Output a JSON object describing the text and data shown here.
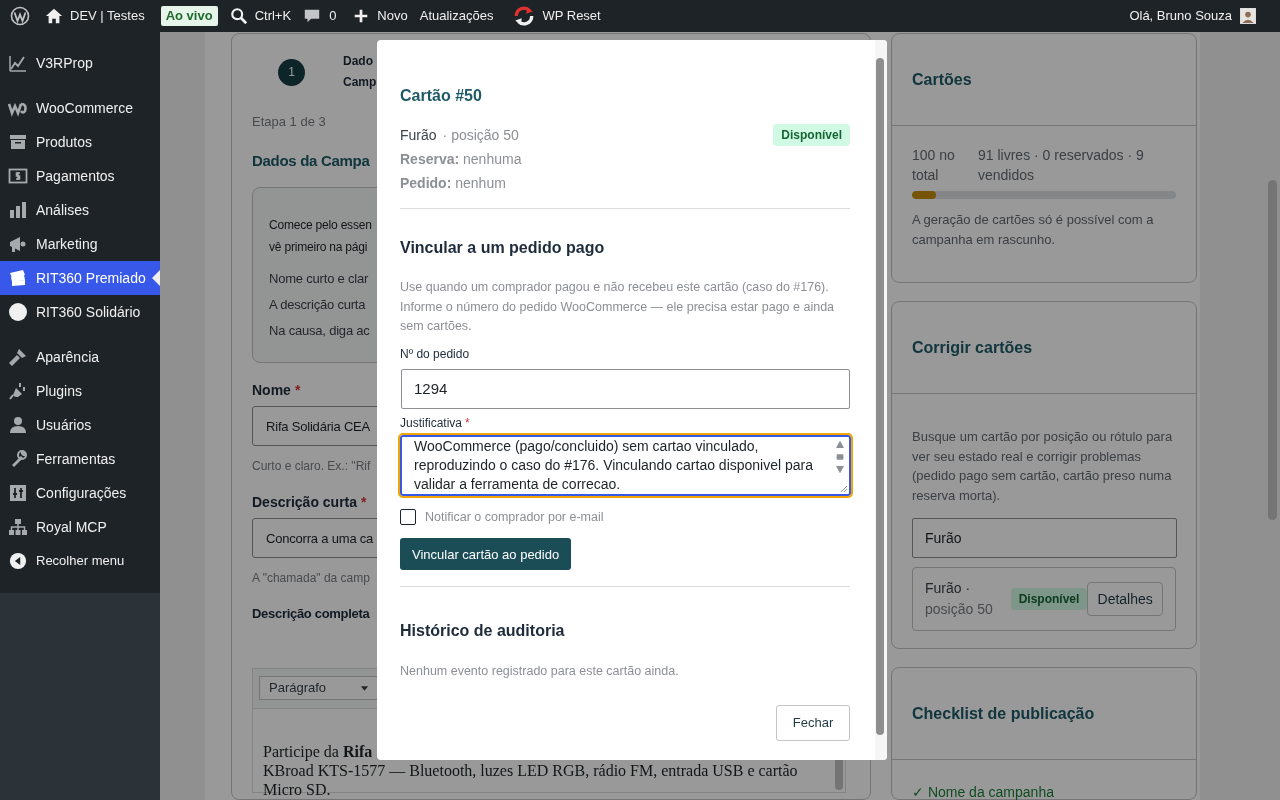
{
  "admin_bar": {
    "items": [
      {
        "kind": "logo"
      },
      {
        "kind": "home",
        "label": "DEV | Testes"
      },
      {
        "kind": "badge",
        "label": "Ao vivo"
      },
      {
        "kind": "search",
        "label": "Ctrl+K"
      },
      {
        "kind": "comments",
        "label": "0"
      },
      {
        "kind": "new",
        "label": "Novo"
      },
      {
        "kind": "text",
        "label": "Atualizações"
      },
      {
        "kind": "reset",
        "label": "WP Reset"
      }
    ],
    "greeting": "Olá, Bruno Souza"
  },
  "sidebar": {
    "groups": [
      [
        {
          "label": "V3RProp",
          "selected": false
        }
      ],
      [
        {
          "label": "WooCommerce",
          "selected": false
        },
        {
          "label": "Produtos",
          "selected": false
        },
        {
          "label": "Pagamentos",
          "selected": false
        },
        {
          "label": "Análises",
          "selected": false
        },
        {
          "label": "Marketing",
          "selected": false
        },
        {
          "label": "RIT360 Premiado",
          "selected": true
        },
        {
          "label": "RIT360 Solidário",
          "selected": false
        }
      ],
      [
        {
          "label": "Aparência",
          "selected": false
        },
        {
          "label": "Plugins",
          "selected": false
        },
        {
          "label": "Usuários",
          "selected": false
        },
        {
          "label": "Ferramentas",
          "selected": false
        },
        {
          "label": "Configurações",
          "selected": false
        },
        {
          "label": "Royal MCP",
          "selected": false
        }
      ]
    ],
    "collapse": "Recolher menu"
  },
  "main": {
    "stepper": {
      "number": "1",
      "label_lines": [
        "Dado",
        "Camp"
      ]
    },
    "step_text": "Etapa 1 de 3",
    "heading": "Dados da Campa",
    "intro": {
      "lines": [
        "Comece pelo essen",
        "vê primeiro na pági"
      ],
      "tips": [
        "Nome curto e clar",
        "A descrição curta",
        "Na causa, diga ac"
      ]
    },
    "fields": [
      {
        "label": "Nome",
        "required_mark": "*",
        "value": "Rifa Solidária CEA",
        "help": "Curto e claro. Ex.: \"Rif"
      },
      {
        "label": "Descrição curta",
        "required_mark": "*",
        "value": "Concorra a uma ca",
        "help": "A \"chamada\" da camp"
      }
    ],
    "full_description": {
      "label": "Descrição completa",
      "format": "Parágrafo",
      "lines": [
        "Participe da **Rifa**",
        "KBroad KTS-1577 — Bluetooth, luzes LED RGB, rádio FM, entrada USB e cartão",
        "Micro SD."
      ]
    }
  },
  "side_panels": {
    "summary": {
      "title": "Cartões",
      "total": "100 no total",
      "breakdown": "91 livres · 0 reservados · 9 vendidos",
      "level": 0.09,
      "note": "A geração de cartões só é possível com a campanha em rascunho."
    },
    "fix": {
      "title": "Corrigir cartões",
      "description": "Busque um cartão por posição ou rótulo para ver seu estado real e corrigir problemas (pedido pago sem cartão, cartão preso numa reserva morta).",
      "search_value": "Furão",
      "result": {
        "label": "Furão ·",
        "position": "posição 50",
        "status": "Disponível",
        "action": "Detalhes"
      }
    },
    "checklist": {
      "title": "Checklist de publicação",
      "items": [
        {
          "label": "✓ Nome da campanha",
          "done": true
        }
      ]
    }
  },
  "modal": {
    "title": "Cartão #50",
    "card_label": "Furão",
    "position": "· posição 50",
    "status": "Disponível",
    "details": [
      {
        "label": "Reserva:",
        "value": "nenhuma"
      },
      {
        "label": "Pedido:",
        "value": "nenhum"
      }
    ],
    "link_section": {
      "heading": "Vincular a um pedido pago",
      "description": "Use quando um comprador pagou e não recebeu este cartão (caso do #176). Informe o número do pedido WooCommerce — ele precisa estar pago e ainda sem cartões.",
      "order_label": "Nº do pedido",
      "order_value": "1294",
      "justification_label": "Justificativa",
      "required_mark": "*",
      "justification_value": "WooCommerce (pago/concluido) sem cartao vinculado, reproduzindo o caso do #176. Vinculando cartao disponivel para validar a ferramenta de correcao.",
      "notify": {
        "label": "Notificar o comprador por e-mail",
        "checked": false
      },
      "submit": "Vincular cartão ao pedido"
    },
    "audit": {
      "heading": "Histórico de auditoria",
      "empty": "Nenhum evento registrado para este cartão ainda."
    },
    "close": "Fechar"
  }
}
